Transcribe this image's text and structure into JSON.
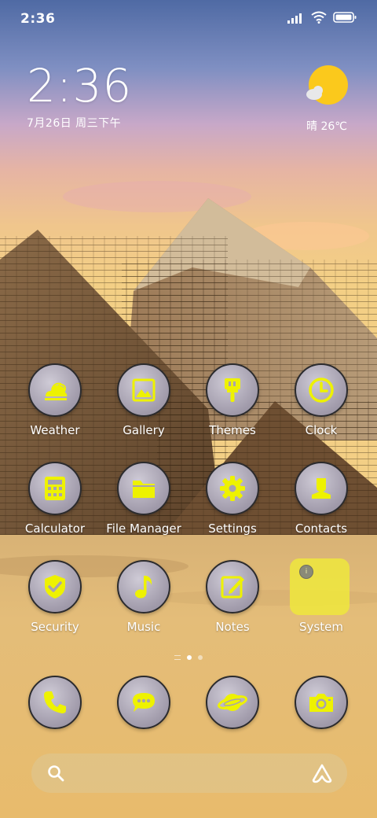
{
  "status_bar": {
    "time": "2:36",
    "icons": [
      "signal-icon",
      "wifi-icon",
      "battery-icon"
    ]
  },
  "clock_widget": {
    "time": "2:36",
    "date": "7月26日 周三下午"
  },
  "weather_widget": {
    "icon": "sun-cloud-icon",
    "text": "晴 26℃"
  },
  "apps": [
    {
      "label": "Weather",
      "icon": "weather-icon"
    },
    {
      "label": "Gallery",
      "icon": "gallery-icon"
    },
    {
      "label": "Themes",
      "icon": "paintbrush-icon"
    },
    {
      "label": "Clock",
      "icon": "clock-icon"
    },
    {
      "label": "Calculator",
      "icon": "calculator-icon"
    },
    {
      "label": "File Manager",
      "icon": "folder-icon"
    },
    {
      "label": "Settings",
      "icon": "gear-icon"
    },
    {
      "label": "Contacts",
      "icon": "contact-icon"
    },
    {
      "label": "Security",
      "icon": "shield-icon"
    },
    {
      "label": "Music",
      "icon": "music-note-icon"
    },
    {
      "label": "Notes",
      "icon": "notes-icon"
    },
    {
      "label": "System",
      "icon": "system-folder-icon"
    }
  ],
  "dock": [
    {
      "icon": "phone-icon"
    },
    {
      "icon": "messages-icon"
    },
    {
      "icon": "browser-planet-icon"
    },
    {
      "icon": "camera-icon"
    }
  ],
  "search_bar": {
    "left_icon": "search-icon",
    "right_icon": "assistant-icon"
  },
  "colors": {
    "icon_accent": "#EEF200",
    "icon_bg": "#A7A2B0",
    "icon_border": "#2B2B2E"
  }
}
